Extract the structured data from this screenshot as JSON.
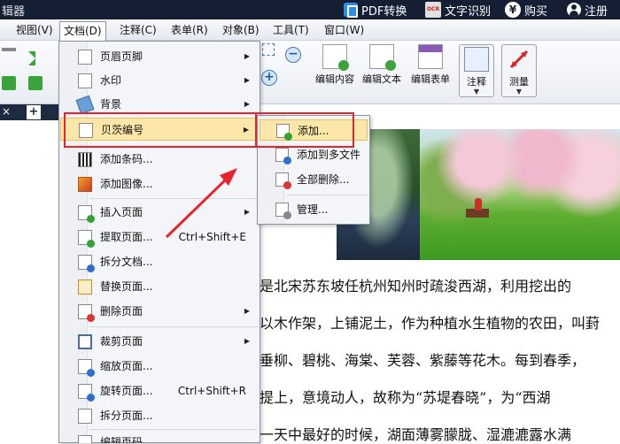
{
  "titlebar": {
    "app_title": "辑器",
    "pdf_convert": "PDF转换",
    "ocr": "文字识别",
    "ocr_icon_text": "OCR",
    "buy": "购买",
    "buy_icon": "¥",
    "register": "注册"
  },
  "menubar": {
    "items": [
      "视图(V)",
      "文档(D)",
      "注释(C)",
      "表单(R)",
      "对象(B)",
      "工具(T)",
      "窗口(W)"
    ]
  },
  "toolbar": {
    "edit_content": "编辑内容",
    "edit_text": "编辑文本",
    "edit_form": "编辑表单",
    "comment": "注释",
    "measure": "测量",
    "zoom_in": "+",
    "zoom_out": "−"
  },
  "tabstrip": {
    "close": "×",
    "add": "+"
  },
  "document_menu": {
    "items": [
      {
        "label": "页眉页脚",
        "shortcut": "",
        "submenu": true
      },
      {
        "label": "水印",
        "shortcut": "",
        "submenu": true
      },
      {
        "label": "背景",
        "shortcut": "",
        "submenu": true
      },
      {
        "label": "贝茨编号",
        "shortcut": "",
        "submenu": true
      },
      {
        "label": "添加条码...",
        "shortcut": "",
        "submenu": false
      },
      {
        "label": "添加图像...",
        "shortcut": "",
        "submenu": false
      },
      {
        "label": "插入页面",
        "shortcut": "",
        "submenu": true
      },
      {
        "label": "提取页面...",
        "shortcut": "Ctrl+Shift+E",
        "submenu": false
      },
      {
        "label": "拆分文档...",
        "shortcut": "",
        "submenu": false
      },
      {
        "label": "替换页面...",
        "shortcut": "",
        "submenu": false
      },
      {
        "label": "删除页面",
        "shortcut": "",
        "submenu": true
      },
      {
        "label": "裁剪页面",
        "shortcut": "",
        "submenu": true
      },
      {
        "label": "缩放页面...",
        "shortcut": "",
        "submenu": false
      },
      {
        "label": "旋转页面...",
        "shortcut": "Ctrl+Shift+R",
        "submenu": false
      },
      {
        "label": "拆分页面...",
        "shortcut": "",
        "submenu": false
      },
      {
        "label": "编辑页码",
        "shortcut": "",
        "submenu": false
      }
    ],
    "arrow_glyph": "▶"
  },
  "bates_submenu": {
    "items": [
      {
        "label": "添加..."
      },
      {
        "label": "添加到多文件"
      },
      {
        "label": "全部删除..."
      },
      {
        "label": "管理..."
      }
    ]
  },
  "document_text": {
    "lines": [
      "是北宋苏东坡任杭州知州时疏浚西湖，利用挖出的",
      "以木作架，上铺泥土，作为种植水生植物的农田，叫葑",
      "垂柳、碧桃、海棠、芙蓉、紫藤等花木。每到春季，",
      "提上，意境动人，故称为“苏堤春晓”，为“西湖",
      "一天中最好的时候，湖面薄雾朦胧、湿漉漉露水满"
    ]
  },
  "colors": {
    "titlebar_bg": "#141f33",
    "highlight_bg": "#fde7a8",
    "annotation_red": "#e8232e"
  }
}
